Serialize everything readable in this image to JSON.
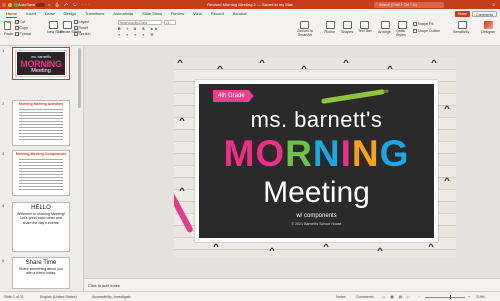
{
  "titlebar": {
    "autosave": "AutoSave",
    "toggle": "OFF",
    "icons": "⌂ ⎙ ↶ ↻ ···",
    "document_title": "Revised Morning Meeting 2 — Saved to my Mac",
    "search_placeholder": "Search (Cmd + Ctrl + U)",
    "right_icons": "☺"
  },
  "tabs": [
    "Home",
    "Insert",
    "Draw",
    "Design",
    "Transitions",
    "Animations",
    "Slide Show",
    "Review",
    "View",
    "Record",
    "Acrobat"
  ],
  "tab_actions": {
    "share": "Share",
    "comments": "Comments"
  },
  "ribbon": {
    "paste": "Paste",
    "cut": "Cut",
    "copy": "Copy",
    "format": "Format",
    "new_slide": "New Slide",
    "reuse_slides": "Reuse Slides",
    "layout": "Layout",
    "reset": "Reset",
    "section": "Section",
    "font_name": "HelloVickyBoChina",
    "font_size": "26",
    "convert_smartart": "Convert to SmartArt",
    "picture": "Picture",
    "shapes": "Shapes",
    "text_box": "Text Box",
    "arrange": "Arrange",
    "quick_styles": "Quick Styles",
    "shape_fill": "Shape Fill",
    "shape_outline": "Shape Outline",
    "sensitivity": "Sensitivity",
    "designer": "Designer"
  },
  "thumbnails": [
    {
      "number": "1",
      "name": "ms. barnett's",
      "title": "MORNING",
      "subtitle": "Meeting"
    },
    {
      "number": "2",
      "head": "Morning Meeting Activities"
    },
    {
      "number": "3",
      "head": "Morning Meeting Components"
    },
    {
      "number": "4",
      "title": "HELLO",
      "body": "Welcome to Morning Meeting! Let's greet each other and share the day's events."
    },
    {
      "number": "5",
      "title": "Share Time",
      "body": "Share something about you with a friend today."
    }
  ],
  "slide": {
    "grade": "4th Grade",
    "name": "ms. barnett's",
    "morning_letters": [
      "M",
      "O",
      "R",
      "N",
      "I",
      "N",
      "G"
    ],
    "morning_colors": [
      "#ee2f8a",
      "#ee2f8a",
      "#6cc24a",
      "#19a8e0",
      "#ee2f8a",
      "#f6a21c",
      "#19a8e0"
    ],
    "meeting": "Meeting",
    "components": "w/ components",
    "copyright": "© 2021 Barnett's School House"
  },
  "notes": {
    "placeholder": "Click to add notes"
  },
  "statusbar": {
    "slide_info": "Slide 1 of 11",
    "language": "English (United States)",
    "accessibility": "Accessibility: Investigate",
    "notes": "Notes",
    "comments": "Comments",
    "zoom": "119%",
    "zoom_fraction": 0.62
  },
  "colors": {
    "accent": "#c43e1c",
    "pink": "#ee2f8a",
    "board": "#2a2a2a"
  }
}
